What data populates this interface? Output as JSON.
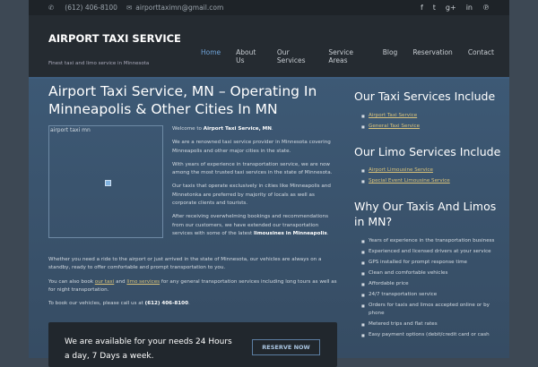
{
  "topbar": {
    "phone": "(612) 406-8100",
    "email": "airporttaximn@gmail.com",
    "social": [
      "facebook",
      "twitter",
      "google-plus",
      "linkedin",
      "pinterest"
    ]
  },
  "header": {
    "logo": "AIRPORT TAXI SERVICE",
    "tagline": "Finest taxi and limo service in Minnesota",
    "nav": [
      "Home",
      "About Us",
      "Our Services",
      "Service Areas",
      "Blog",
      "Reservation",
      "Contact"
    ]
  },
  "main": {
    "title": "Airport Taxi Service, MN – Operating In Minneapolis & Other Cities In MN",
    "image_alt": "airport taxi mn",
    "p1a": "Welcome to ",
    "p1b": "Airport Taxi Service, MN",
    "p2": "We are a renowned taxi service provider in Minnesota covering Minneapolis and other major cities in the state.",
    "p3": "With years of experience in transportation service, we are now among the most trusted taxi services in the state of Minnesota.",
    "p4": "Our taxis that operate exclusively in cities like Minneapolis and Minnetonka are preferred by majority of locals as well as corporate clients and tourists.",
    "p5a": "After receiving overwhelming bookings and recommendations from our customers, we have extended our transportation services with some of the latest ",
    "p5b": "limousines in Minneapolis",
    "p6": "Whether you need a ride to the airport or just arrived in the state of Minnesota, our vehicles are always on a standby, ready to offer comfortable and prompt transportation to you.",
    "p7a": "You can also book ",
    "p7link1": "our taxi",
    "p7b": " and ",
    "p7link2": "limo services",
    "p7c": " for any general transportation services including long tours as well as for night transportation.",
    "p8a": "To book our vehicles, please call us at ",
    "p8b": "(612) 406-8100",
    "cta_text": "We are available for your needs 24 Hours a day, 7 Days a week.",
    "cta_button": "RESERVE NOW"
  },
  "sidebar": {
    "h1": "Our Taxi Services Include",
    "taxi": [
      "Airport Taxi Service",
      "General Taxi Service"
    ],
    "h2": "Our Limo Services Include",
    "limo": [
      "Airport Limousine Service",
      "Special Event Limousine Service"
    ],
    "h3": "Why Our Taxis And Limos in MN?",
    "why": [
      "Years of experience in the transportation business",
      "Experienced and licensed drivers at your service",
      "GPS installed for prompt response time",
      "Clean and comfortable vehicles",
      "Affordable price",
      "24/7 transportation service",
      "Orders for taxis and limos accepted online or by phone",
      "Metered trips  and flat rates",
      "Easy payment options (debit/credit card or cash"
    ]
  }
}
